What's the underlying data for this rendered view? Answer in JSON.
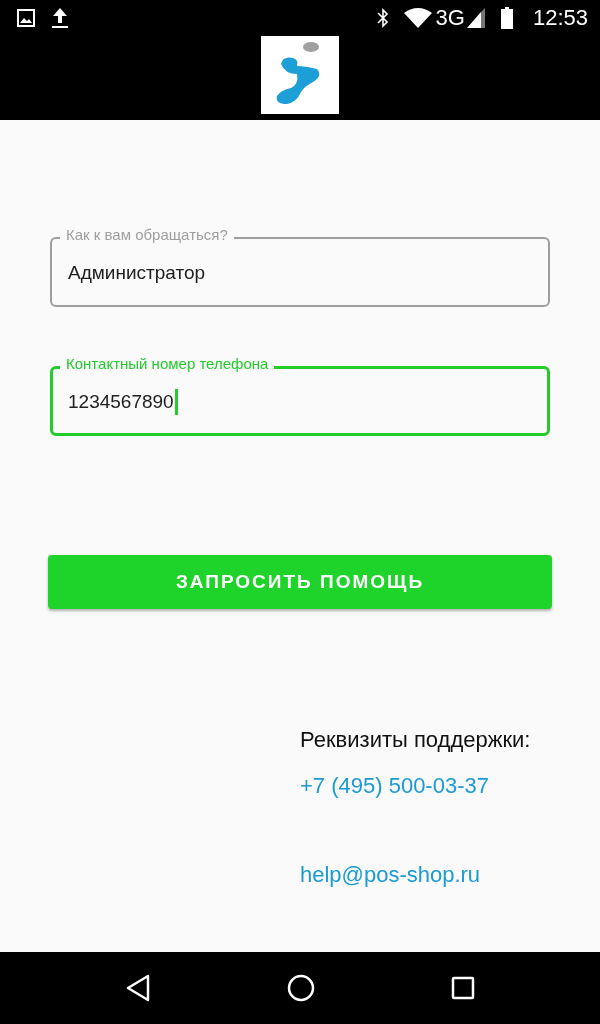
{
  "status_bar": {
    "network": "3G",
    "time": "12:53"
  },
  "form": {
    "fields": [
      {
        "label": "Как к вам обращаться?",
        "value": "Администратор",
        "focused": false
      },
      {
        "label": "Контактный номер телефона",
        "value": "1234567890",
        "focused": true
      }
    ],
    "submit_button": "ЗАПРОСИТЬ ПОМОЩЬ"
  },
  "support": {
    "title": "Реквизиты поддержки:",
    "phone": "+7 (495) 500-03-37",
    "email": "help@pos-shop.ru"
  }
}
